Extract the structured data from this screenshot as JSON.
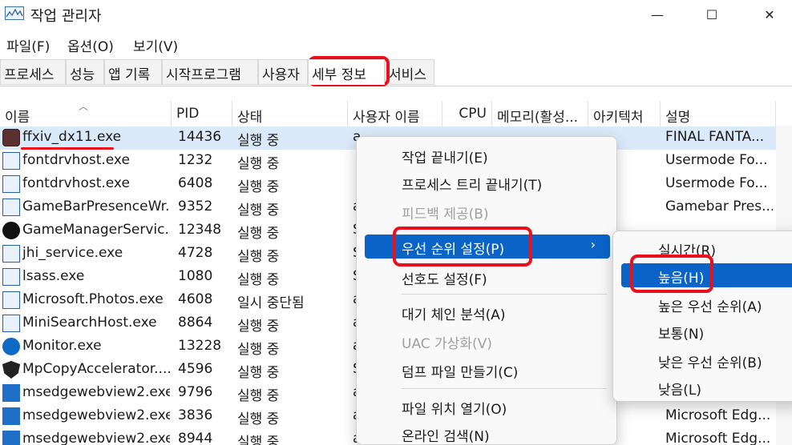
{
  "window": {
    "title": "작업 관리자",
    "minimize": "—",
    "maximize": "☐",
    "close": "✕"
  },
  "menu": [
    "파일(F)",
    "옵션(O)",
    "보기(V)"
  ],
  "tabs": [
    "프로세스",
    "성능",
    "앱 기록",
    "시작프로그램",
    "사용자",
    "세부 정보",
    "서비스"
  ],
  "active_tab": "세부 정보",
  "columns": [
    "이름",
    "PID",
    "상태",
    "사용자 이름",
    "CPU",
    "메모리(활성...",
    "아키텍처",
    "설명"
  ],
  "rows": [
    {
      "icon": "game-icon",
      "name": "ffxiv_dx11.exe",
      "pid": "14436",
      "status": "실행 중",
      "user": "a",
      "cpu": "",
      "mem": "",
      "arch": "",
      "desc": "FINAL FANTA..."
    },
    {
      "icon": "window-icon",
      "name": "fontdrvhost.exe",
      "pid": "1232",
      "status": "실행 중",
      "user": "",
      "cpu": "",
      "mem": "",
      "arch": "",
      "desc": "Usermode Fo..."
    },
    {
      "icon": "window-icon",
      "name": "fontdrvhost.exe",
      "pid": "6408",
      "status": "실행 중",
      "user": "",
      "cpu": "",
      "mem": "",
      "arch": "",
      "desc": "Usermode Fo..."
    },
    {
      "icon": "window-icon",
      "name": "GameBarPresenceWr...",
      "pid": "9352",
      "status": "실행 중",
      "user": "a",
      "cpu": "",
      "mem": "",
      "arch": "",
      "desc": "Gamebar Pres..."
    },
    {
      "icon": "razer-icon",
      "name": "GameManagerServic...",
      "pid": "12348",
      "status": "실행 중",
      "user": "S",
      "cpu": "",
      "mem": "",
      "arch": "",
      "desc": ""
    },
    {
      "icon": "window-icon",
      "name": "jhi_service.exe",
      "pid": "4728",
      "status": "실행 중",
      "user": "S",
      "cpu": "",
      "mem": "",
      "arch": "",
      "desc": ""
    },
    {
      "icon": "window-icon",
      "name": "lsass.exe",
      "pid": "1080",
      "status": "실행 중",
      "user": "S",
      "cpu": "",
      "mem": "",
      "arch": "",
      "desc": ""
    },
    {
      "icon": "window-icon",
      "name": "Microsoft.Photos.exe",
      "pid": "4608",
      "status": "일시 중단됨",
      "user": "a",
      "cpu": "",
      "mem": "",
      "arch": "",
      "desc": ""
    },
    {
      "icon": "window-icon",
      "name": "MiniSearchHost.exe",
      "pid": "8864",
      "status": "실행 중",
      "user": "a",
      "cpu": "",
      "mem": "",
      "arch": "",
      "desc": ""
    },
    {
      "icon": "monitor-icon",
      "name": "Monitor.exe",
      "pid": "13228",
      "status": "실행 중",
      "user": "a",
      "cpu": "",
      "mem": "",
      "arch": "",
      "desc": ""
    },
    {
      "icon": "shield-icon",
      "name": "MpCopyAccelerator....",
      "pid": "4596",
      "status": "실행 중",
      "user": "S",
      "cpu": "",
      "mem": "",
      "arch": "",
      "desc": ""
    },
    {
      "icon": "edge-icon",
      "name": "msedgewebview2.exe",
      "pid": "9796",
      "status": "실행 중",
      "user": "a",
      "cpu": "",
      "mem": "",
      "arch": "",
      "desc": ""
    },
    {
      "icon": "edge-icon",
      "name": "msedgewebview2.exe",
      "pid": "3836",
      "status": "실행 중",
      "user": "a",
      "cpu": "",
      "mem": "",
      "arch": "",
      "desc": "Microsoft Edg..."
    },
    {
      "icon": "edge-icon",
      "name": "msedgewebview2.exe",
      "pid": "8944",
      "status": "실행 중",
      "user": "a",
      "cpu": "",
      "mem": "",
      "arch": "",
      "desc": "Microsoft Edg..."
    }
  ],
  "context_menu": {
    "items": [
      {
        "label": "작업 끝내기(E)",
        "disabled": false
      },
      {
        "label": "프로세스 트리 끝내기(T)",
        "disabled": false
      },
      {
        "label": "피드백 제공(B)",
        "disabled": true
      },
      {
        "label": "우선 순위 설정(P)",
        "disabled": false,
        "submenu": true
      },
      {
        "label": "선호도 설정(F)",
        "disabled": false
      },
      {
        "label": "대기 체인 분석(A)",
        "disabled": false
      },
      {
        "label": "UAC 가상화(V)",
        "disabled": true
      },
      {
        "label": "덤프 파일 만들기(C)",
        "disabled": false
      },
      {
        "label": "파일 위치 열기(O)",
        "disabled": false
      },
      {
        "label": "온라인 검색(N)",
        "disabled": false
      }
    ],
    "chevron": "›"
  },
  "priority_submenu": {
    "items": [
      "실시간(R)",
      "높음(H)",
      "높은 우선 순위(A)",
      "보통(N)",
      "낮은 우선 순위(B)",
      "낮음(L)"
    ],
    "highlighted": "높음(H)"
  },
  "colors": {
    "accent": "#0a64c8",
    "selected_row": "#dbeafa",
    "annotation": "#e8101c"
  }
}
